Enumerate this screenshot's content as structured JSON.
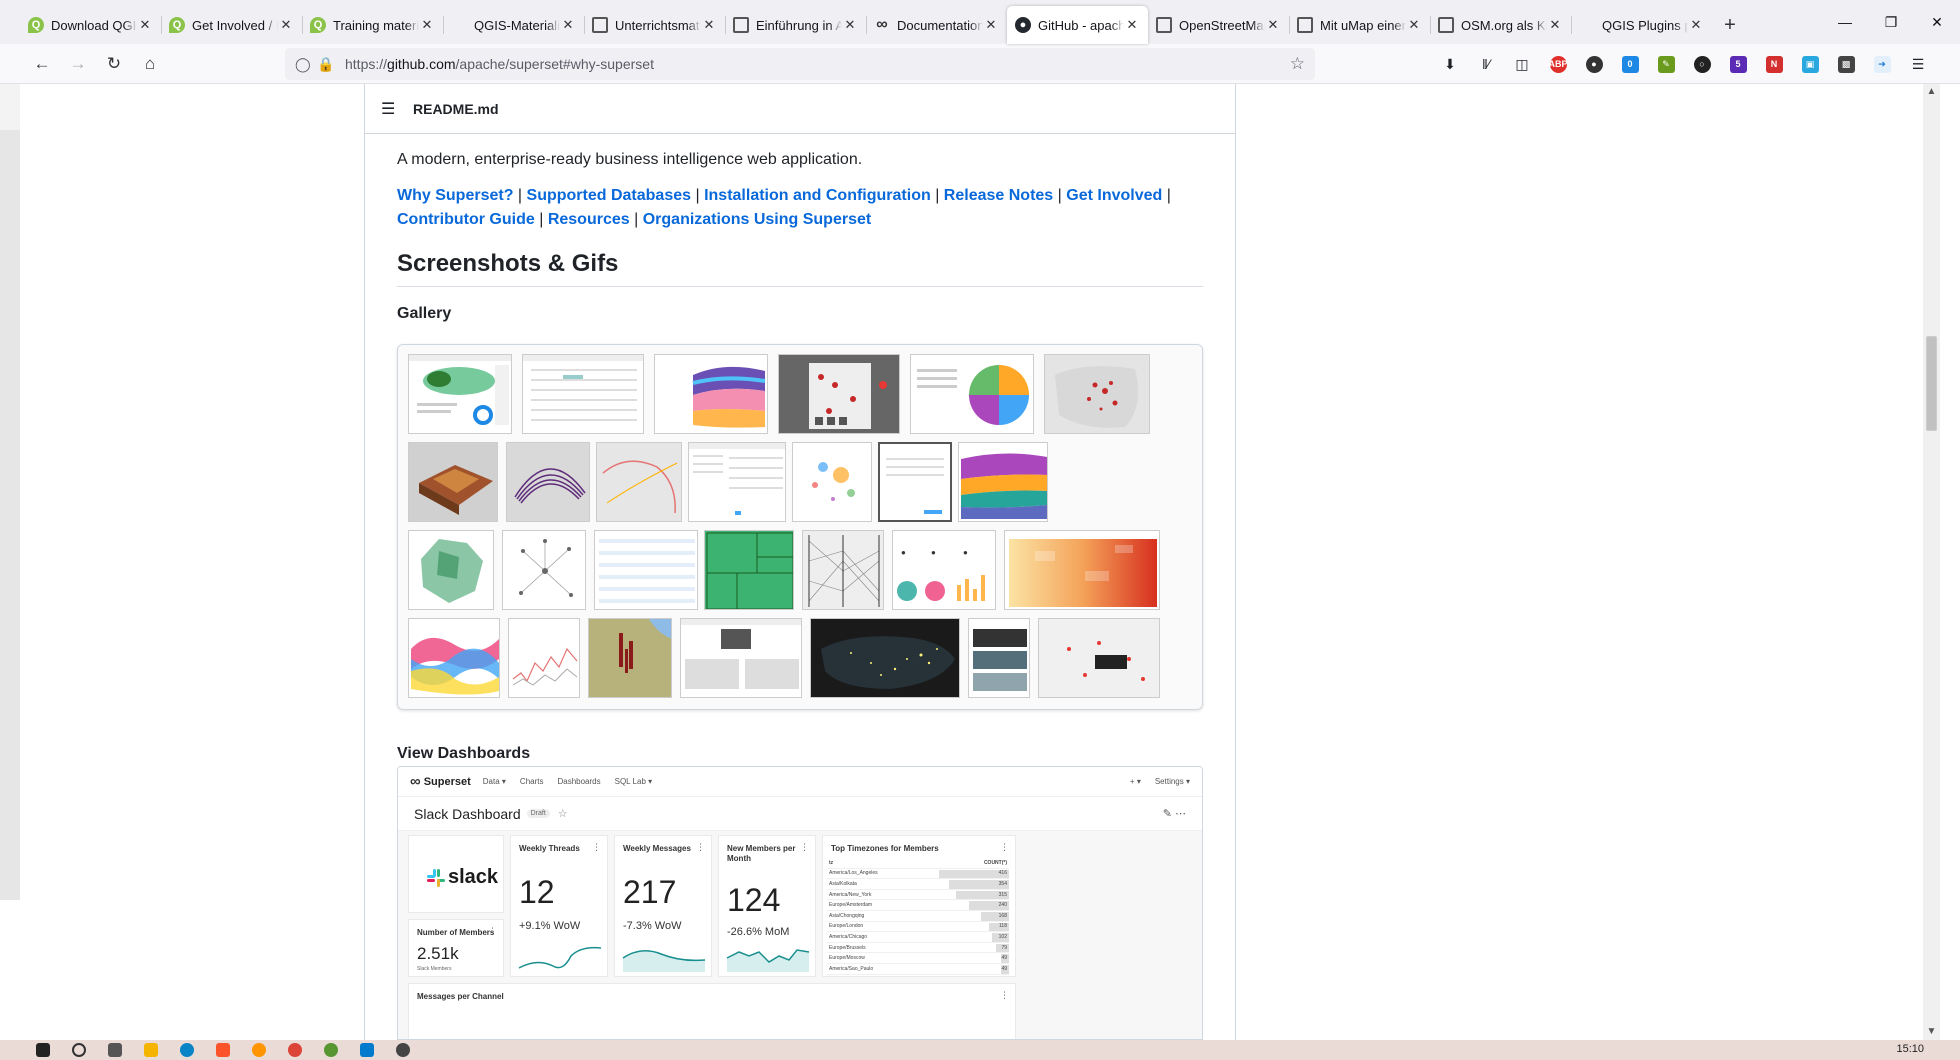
{
  "tabs": [
    {
      "title": "Download QGIS",
      "icon": "qgis-icon"
    },
    {
      "title": "Get Involved / D",
      "icon": "qgis-icon"
    },
    {
      "title": "Training material",
      "icon": "qgis-icon"
    },
    {
      "title": "QGIS-Materialien – i",
      "icon": "none"
    },
    {
      "title": "Unterrichtsmate",
      "icon": "map-icon"
    },
    {
      "title": "Einführung in Ai",
      "icon": "map-icon"
    },
    {
      "title": "Documentation",
      "icon": "infinity-icon"
    },
    {
      "title": "GitHub - apache",
      "icon": "github-icon",
      "active": true
    },
    {
      "title": "OpenStreetMap",
      "icon": "map-icon"
    },
    {
      "title": "Mit uMap einen",
      "icon": "map-icon"
    },
    {
      "title": "OSM.org als Kar",
      "icon": "map-icon"
    },
    {
      "title": "QGIS Plugins planet",
      "icon": "none"
    }
  ],
  "url": {
    "prefix": "https://",
    "host": "github.com",
    "path": "/apache/superset#why-superset"
  },
  "readme": {
    "filename": "README.md",
    "lead": "A modern, enterprise-ready business intelligence web application.",
    "links": [
      "Why Superset?",
      "Supported Databases",
      "Installation and Configuration",
      "Release Notes",
      "Get Involved",
      "Contributor Guide",
      "Resources",
      "Organizations Using Superset"
    ],
    "separator": "|",
    "heading_screenshots": "Screenshots & Gifs",
    "heading_gallery": "Gallery",
    "heading_dashboards": "View Dashboards"
  },
  "dashboard": {
    "brand": "Superset",
    "nav": [
      "Data ▾",
      "Charts",
      "Dashboards",
      "SQL Lab ▾"
    ],
    "nav_right": [
      "+ ▾",
      "Settings ▾"
    ],
    "name": "Slack Dashboard",
    "badge": "Draft",
    "slack_logo": "slack",
    "cards": {
      "threads": {
        "title": "Weekly Threads",
        "value": "12",
        "delta": "+9.1% WoW"
      },
      "messages": {
        "title": "Weekly Messages",
        "value": "217",
        "delta": "-7.3% WoW"
      },
      "members_month": {
        "title": "New Members per Month",
        "value": "124",
        "delta": "-26.6% MoM"
      },
      "members": {
        "title": "Number of Members",
        "value": "2.51k",
        "sub": "Slack Members"
      },
      "channel": {
        "title": "Messages per Channel"
      }
    },
    "timezones": {
      "title": "Top Timezones for Members",
      "col_name": "tz",
      "col_value": "COUNT(*)",
      "rows": [
        {
          "tz": "America/Los_Angeles",
          "count": 416
        },
        {
          "tz": "Asia/Kolkata",
          "count": 354
        },
        {
          "tz": "America/New_York",
          "count": 315
        },
        {
          "tz": "Europe/Amsterdam",
          "count": 240
        },
        {
          "tz": "Asia/Chongqing",
          "count": 168
        },
        {
          "tz": "Europe/London",
          "count": 118
        },
        {
          "tz": "America/Chicago",
          "count": 102
        },
        {
          "tz": "Europe/Brussels",
          "count": 79
        },
        {
          "tz": "Europe/Moscow",
          "count": 49
        },
        {
          "tz": "America/Sao_Paulo",
          "count": 49
        }
      ]
    }
  },
  "clock": "15:10"
}
